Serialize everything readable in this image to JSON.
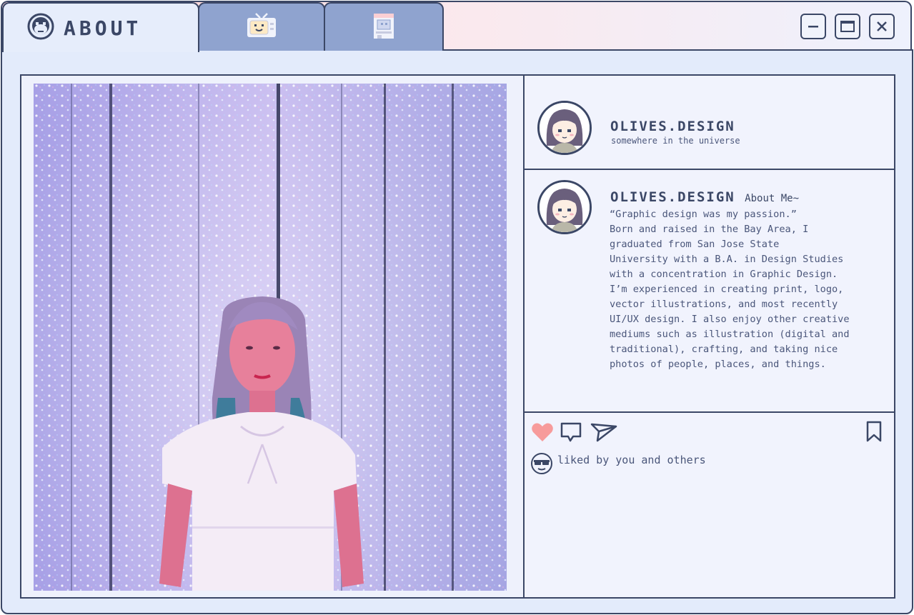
{
  "window": {
    "tabs": [
      {
        "label": "ABOUT",
        "icon": "monkey-face-icon",
        "active": true
      },
      {
        "label": "",
        "icon": "retro-tv-icon",
        "active": false
      },
      {
        "label": "",
        "icon": "arcade-cabinet-icon",
        "active": false
      }
    ],
    "controls": {
      "minimize": "minimize-icon",
      "maximize": "maximize-icon",
      "close": "close-icon"
    }
  },
  "post": {
    "photo_alt": "photo-of-person-in-light-installation",
    "header": {
      "username": "OLIVES.DESIGN",
      "location": "somewhere in the universe"
    },
    "caption": {
      "username": "OLIVES.DESIGN",
      "heading": "About Me~",
      "lines": [
        "“Graphic design was my passion.”",
        "Born and raised in the Bay Area, I",
        "graduated from San Jose State",
        "University with a B.A. in Design Studies",
        "with a concentration in Graphic Design.",
        "I’m experienced in creating print, logo,",
        "vector illustrations, and most recently",
        "UI/UX design. I also enjoy other creative",
        "mediums such as illustration (digital and",
        "traditional), crafting, and taking nice",
        "photos of people, places, and things."
      ]
    },
    "actions": {
      "like": "heart-icon",
      "comment": "comment-icon",
      "share": "send-icon",
      "save": "bookmark-icon"
    },
    "likes_text": "liked by you and others"
  },
  "colors": {
    "outline": "#3b4766",
    "body": "#e3ebfb",
    "tab_inactive": "#8fa3cf",
    "heart": "#f79b9b",
    "title_gradient_start": "#fdd0d0"
  }
}
